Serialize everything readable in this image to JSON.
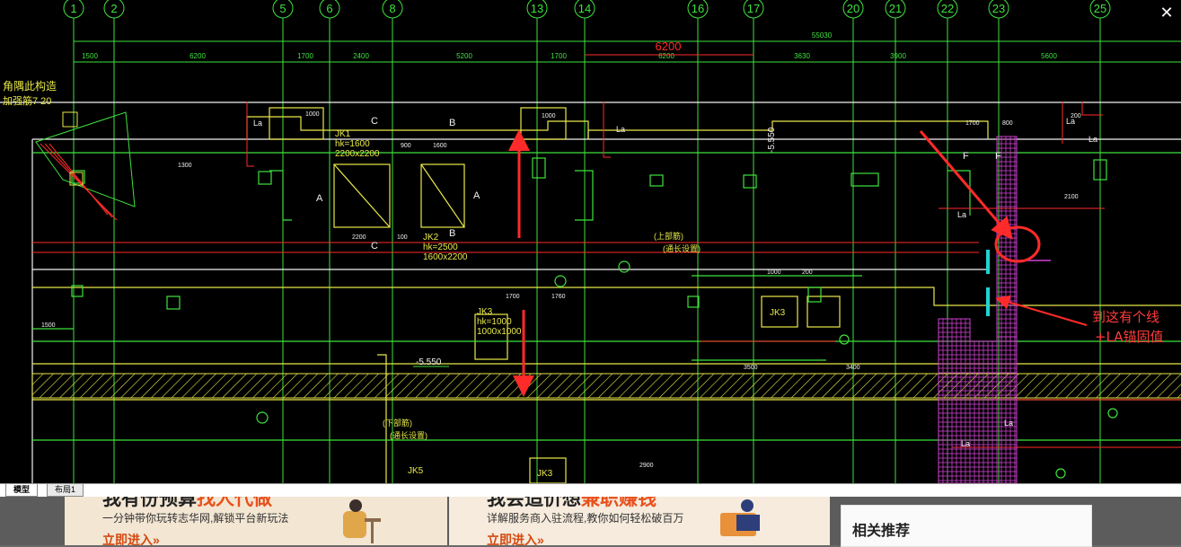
{
  "viewer": {
    "close_glyph": "✕",
    "tabs": [
      {
        "label": "模型",
        "active": true
      },
      {
        "label": "布局1",
        "active": false
      }
    ]
  },
  "drawing": {
    "axis_labels": [
      "1",
      "2",
      "5",
      "6",
      "8",
      "13",
      "14",
      "16",
      "17",
      "20",
      "21",
      "22",
      "23",
      "25"
    ],
    "overall_dim": "55030",
    "segment_dims": [
      "1500",
      "6200",
      "1700",
      "2400",
      "5200",
      "1700",
      "6200",
      "3630",
      "3900",
      "5600"
    ],
    "highlight_dim": "6200",
    "section_marks": [
      "A",
      "A",
      "B",
      "B",
      "C",
      "C",
      "F",
      "F"
    ],
    "elevations": [
      "-5.550",
      "-5.550"
    ],
    "corner_note_1": "角隅此构造",
    "corner_note_2": "加强筋7 20",
    "tags": {
      "jk1": [
        "JK1",
        "hk=1600",
        "2200x2200"
      ],
      "jk2": [
        "JK2",
        "hk=2500",
        "1600x2200"
      ],
      "jk3_left": [
        "JK3",
        "hk=1000",
        "1000x1000"
      ],
      "jk3_mid": "JK3",
      "jk3_low": "JK3",
      "jk5": "JK5"
    },
    "dims_misc": [
      "1000",
      "1600",
      "1000",
      "900",
      "2200",
      "100",
      "1700",
      "1760",
      "3500",
      "3400",
      "1700",
      "800",
      "2100",
      "1000",
      "200",
      "200",
      "1500",
      "1300",
      "2900"
    ],
    "labels": [
      "La",
      "La",
      "La",
      "La",
      "La",
      "La",
      "La"
    ],
    "rebar_notes": [
      "(上部筋)",
      "(通长设置)",
      "(下部筋)",
      "(通长设置)"
    ]
  },
  "annotation": {
    "line1": "到这有个线",
    "line2": "+LA锚固值"
  },
  "page": {
    "banner1": {
      "headline_pre": "我有份预算",
      "headline_hl": "找人代做",
      "sub": "一分钟带你玩转志华网,解锁平台新玩法",
      "cta": "立即进入»"
    },
    "banner2": {
      "headline_pre": "我会造价想",
      "headline_hl": "兼职赚钱",
      "sub": "详解服务商入驻流程,教你如何轻松破百万",
      "cta": "立即进入»"
    },
    "side_title": "相关推荐"
  },
  "colors": {
    "cad_bg": "#000000",
    "green": "#3ee23e",
    "yellow": "#e8e84a",
    "red": "#ff2a2a",
    "cyan": "#1fd4d4",
    "magenta": "#d040d0",
    "white": "#f2f2f2"
  }
}
